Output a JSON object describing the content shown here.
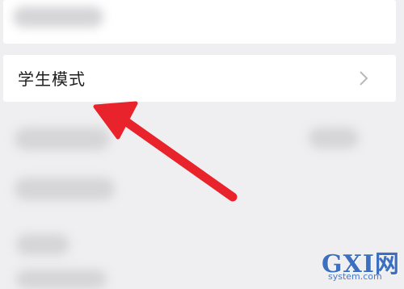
{
  "settings": {
    "student_mode_label": "学生模式"
  },
  "watermark": {
    "logo": "GXI网",
    "site": "system.com"
  },
  "icons": {
    "chevron": "chevron-right-icon",
    "annotation": "red-arrow-annotation"
  },
  "colors": {
    "background": "#efeff1",
    "card": "#ffffff",
    "arrow": "#e8232b"
  }
}
